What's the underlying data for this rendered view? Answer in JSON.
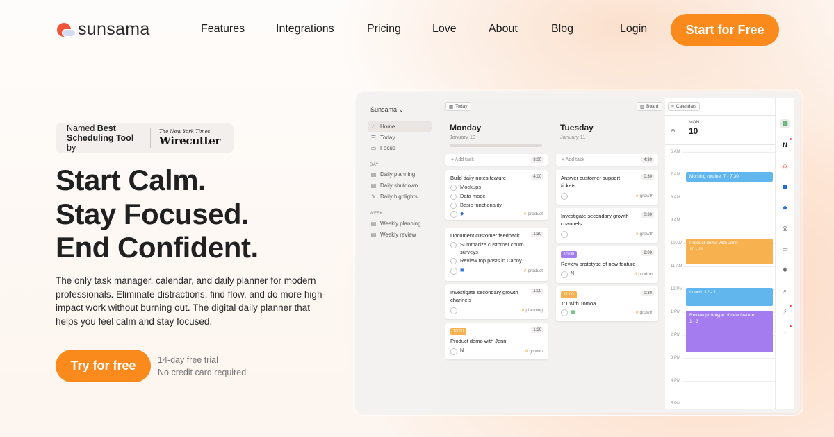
{
  "brand": {
    "name": "sunsama"
  },
  "nav": {
    "links": [
      "Features",
      "Integrations",
      "Pricing",
      "Love",
      "About",
      "Blog"
    ],
    "login": "Login",
    "cta": "Start for Free"
  },
  "badge": {
    "line1_prefix": "Named ",
    "line1_bold": "Best",
    "line2_bold": "Scheduling Tool",
    "line2_suffix": " by",
    "publisher": "The New York Times",
    "product": "Wirecutter"
  },
  "hero": {
    "headline": [
      "Start Calm.",
      "Stay Focused.",
      "End Confident."
    ],
    "subtext": "The only task manager, calendar, and daily planner for modern professionals. Eliminate distractions, find flow, and do more high-impact work without burning out. The digital daily planner that helps you feel calm and stay focused.",
    "cta": "Try for free",
    "trial_line1": "14-day free trial",
    "trial_line2": "No credit card required"
  },
  "app": {
    "workspace": "Sunsama ⌄",
    "sidebar": {
      "nav": [
        "Home",
        "Today",
        "Focus"
      ],
      "day_section": "DAY",
      "day_items": [
        "Daily planning",
        "Daily shutdown",
        "Daily highlights"
      ],
      "week_section": "WEEK",
      "week_items": [
        "Weekly planning",
        "Weekly review"
      ]
    },
    "toolbar": {
      "today": "Today",
      "board": "Board",
      "calendars": "Calendars"
    },
    "monday": {
      "name": "Monday",
      "date": "January 10",
      "add_task": "+ Add task",
      "add_time": "8:00",
      "cards": [
        {
          "title": "Build daily notes feature",
          "time": "4:00",
          "subtasks": [
            "Mockups",
            "Data model",
            "Basic functionality"
          ],
          "tag": "product"
        },
        {
          "title": "Document customer feedback",
          "time": "1:30",
          "subtasks": [
            "Summarize customer churn surveys",
            "Review top posts in Canny"
          ],
          "tag": "product"
        },
        {
          "title": "Investigate secondary growth channels",
          "time": "1:00",
          "tag": "planning"
        },
        {
          "chip": "10:00",
          "title": "Product demo with Jenn",
          "time": "1:30",
          "tag": "growth"
        }
      ]
    },
    "tuesday": {
      "name": "Tuesday",
      "date": "January 11",
      "add_task": "+ Add task",
      "add_time": "4:30",
      "cards": [
        {
          "title": "Answer customer support tickets",
          "time": "0:30",
          "tag": "growth"
        },
        {
          "title": "Investigate secondary growth channels",
          "time": "0:30",
          "tag": "growth"
        },
        {
          "chip": "10:00",
          "title": "Review prototype of new feature",
          "time": "2:00",
          "tag": "product"
        },
        {
          "chip": "11:00",
          "title": "1:1 with Tomoa",
          "time": "0:30",
          "tag": "growth"
        }
      ]
    },
    "calendar": {
      "day": "MON",
      "date": "10",
      "hours": [
        "6 AM",
        "7 AM",
        "8 AM",
        "9 AM",
        "10 AM",
        "11 AM",
        "12 PM",
        "1 PM",
        "2 PM",
        "3 PM",
        "4 PM",
        "5 PM"
      ],
      "events": [
        {
          "title": "Morning routine",
          "time": "7 - 7:30",
          "color": "#62b6ee"
        },
        {
          "title": "Product demo with Jenn",
          "time": "10 - 11",
          "color": "#f7b24f"
        },
        {
          "title": "Lunch",
          "time": "12 - 1",
          "color": "#62b6ee"
        },
        {
          "title": "Review prototype of new feature",
          "time": "1 - 3",
          "color": "#a57cf0"
        }
      ]
    },
    "rail_icons": [
      "google-calendar-icon",
      "notion-icon",
      "asana-icon",
      "trello-icon",
      "jira-icon",
      "github-icon",
      "archive-icon",
      "settings-icon",
      "search-icon",
      "integrations-icon",
      "add-icon"
    ]
  },
  "colors": {
    "accent": "#fb8a1c",
    "logo_sun": "#f0533a"
  }
}
